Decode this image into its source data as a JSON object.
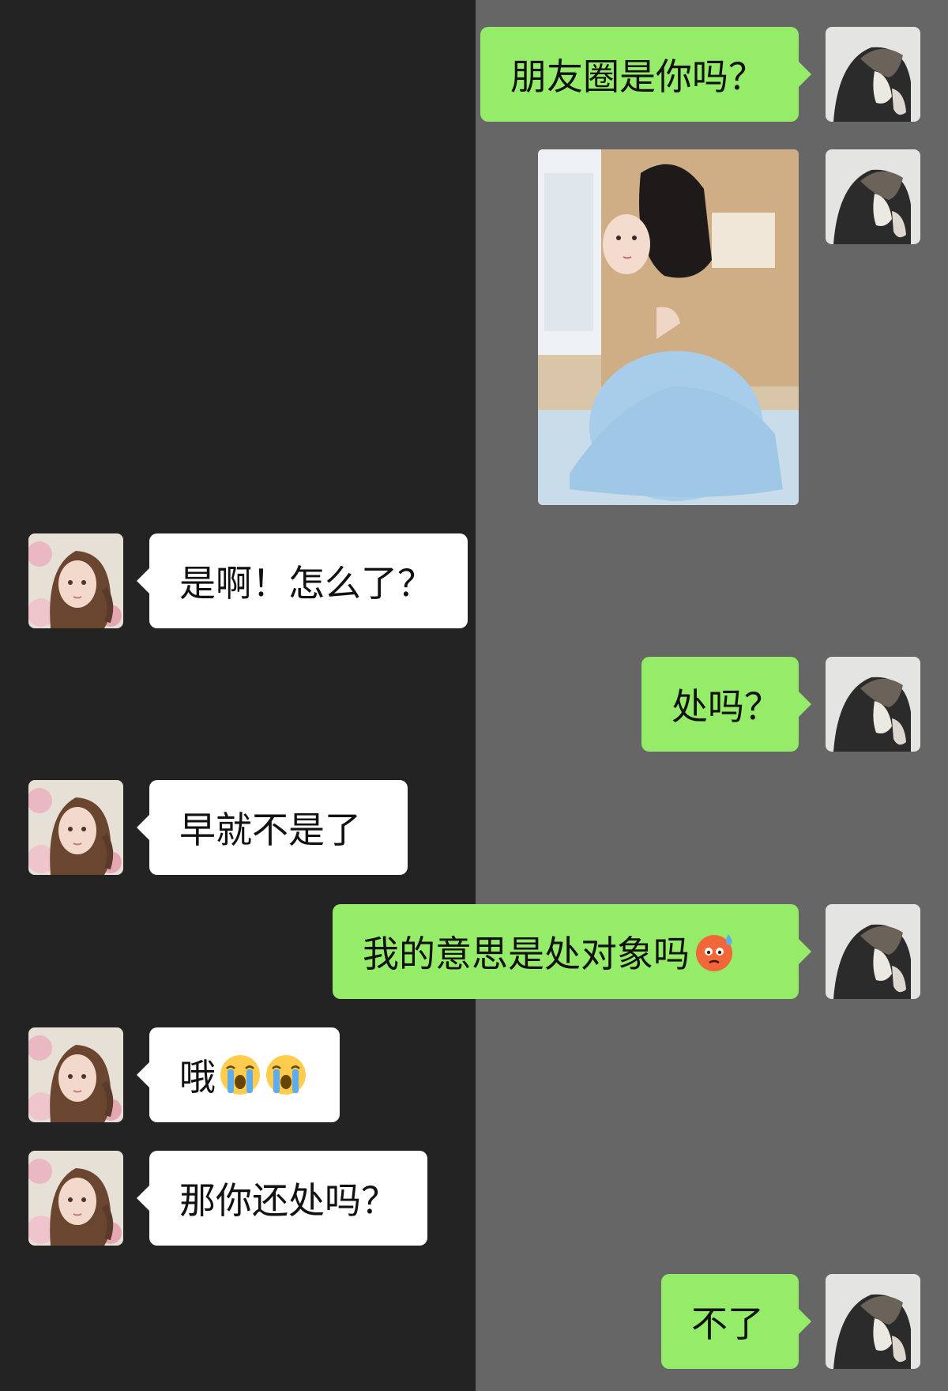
{
  "chat": {
    "messages": [
      {
        "sender": "me",
        "text": "朋友圈是你吗？"
      },
      {
        "sender": "me",
        "type": "image"
      },
      {
        "sender": "friend",
        "text": "是啊！怎么了？"
      },
      {
        "sender": "me",
        "text": "处吗？"
      },
      {
        "sender": "friend",
        "text": "早就不是了"
      },
      {
        "sender": "me",
        "text": "我的意思是处对象吗",
        "emoji": "cold-sweat-face-emoji"
      },
      {
        "sender": "friend",
        "text": "哦",
        "emoji": [
          "loudly-crying-face-emoji",
          "loudly-crying-face-emoji"
        ]
      },
      {
        "sender": "friend",
        "text": "那你还处吗？"
      },
      {
        "sender": "me",
        "text": "不了"
      }
    ]
  },
  "colors": {
    "left_background": "#232323",
    "right_background": "#666666",
    "sent_bubble": "#95ec69",
    "received_bubble": "#ffffff",
    "message_text": "#111111"
  }
}
